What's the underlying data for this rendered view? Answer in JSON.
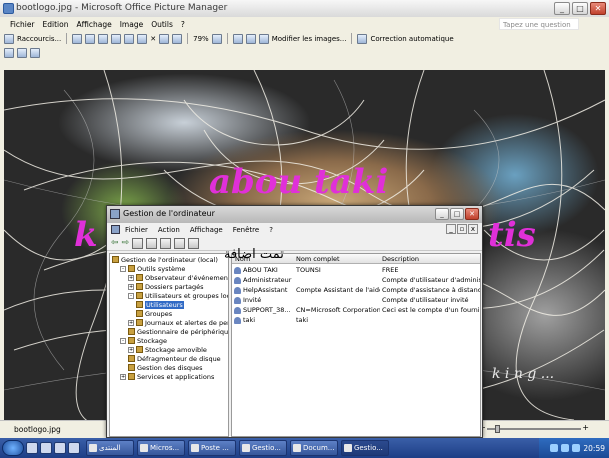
{
  "app": {
    "title": "bootlogo.jpg - Microsoft Office Picture Manager"
  },
  "menu": {
    "items": [
      "Fichier",
      "Edition",
      "Affichage",
      "Image",
      "Outils",
      "?"
    ],
    "help_placeholder": "Tapez une question"
  },
  "toolbar": {
    "raccourcis": "Raccourcis...",
    "zoom": "79%",
    "modifier": "Modifier les images...",
    "correction": "Correction automatique"
  },
  "canvas": {
    "text1": "abou taki",
    "text2_left": "k",
    "text2_right": "tis",
    "text3": "k i n g ..."
  },
  "overlay": {
    "arabic": "تمت اضافة"
  },
  "status": {
    "filename": "bootlogo.jpg"
  },
  "child": {
    "title": "Gestion de l'ordinateur",
    "menu": [
      "Fichier",
      "Action",
      "Affichage",
      "Fenêtre",
      "?"
    ],
    "tree": [
      {
        "label": "Gestion de l'ordinateur (local)",
        "depth": 0,
        "exp": ""
      },
      {
        "label": "Outils système",
        "depth": 1,
        "exp": "-"
      },
      {
        "label": "Observateur d'événements",
        "depth": 2,
        "exp": "+"
      },
      {
        "label": "Dossiers partagés",
        "depth": 2,
        "exp": "+"
      },
      {
        "label": "Utilisateurs et groupes locau",
        "depth": 2,
        "exp": "-"
      },
      {
        "label": "Utilisateurs",
        "depth": 3,
        "exp": "",
        "sel": true
      },
      {
        "label": "Groupes",
        "depth": 3,
        "exp": ""
      },
      {
        "label": "Journaux et alertes de perfo",
        "depth": 2,
        "exp": "+"
      },
      {
        "label": "Gestionnaire de périphérique",
        "depth": 2,
        "exp": ""
      },
      {
        "label": "Stockage",
        "depth": 1,
        "exp": "-"
      },
      {
        "label": "Stockage amovible",
        "depth": 2,
        "exp": "+"
      },
      {
        "label": "Défragmenteur de disque",
        "depth": 2,
        "exp": ""
      },
      {
        "label": "Gestion des disques",
        "depth": 2,
        "exp": ""
      },
      {
        "label": "Services et applications",
        "depth": 1,
        "exp": "+"
      }
    ],
    "columns": [
      "Nom",
      "Nom complet",
      "Description"
    ],
    "rows": [
      [
        "ABOU TAKI",
        "TOUNSI",
        "FREE"
      ],
      [
        "Administrateur",
        "",
        "Compte d'utilisateur d'administratio"
      ],
      [
        "HelpAssistant",
        "Compte Assistant de l'aide...",
        "Compte d'assistance à distance"
      ],
      [
        "Invité",
        "",
        "Compte d'utilisateur invité"
      ],
      [
        "SUPPORT_38...",
        "CN=Microsoft Corporation...",
        "Ceci est le compte d'un fournisseur"
      ],
      [
        "taki",
        "taki",
        ""
      ]
    ]
  },
  "taskbar": {
    "tasks": [
      "المنتدى",
      "Micros...",
      "Poste ...",
      "Gestio...",
      "Docum...",
      "Gestio..."
    ],
    "clock": "20:59"
  }
}
